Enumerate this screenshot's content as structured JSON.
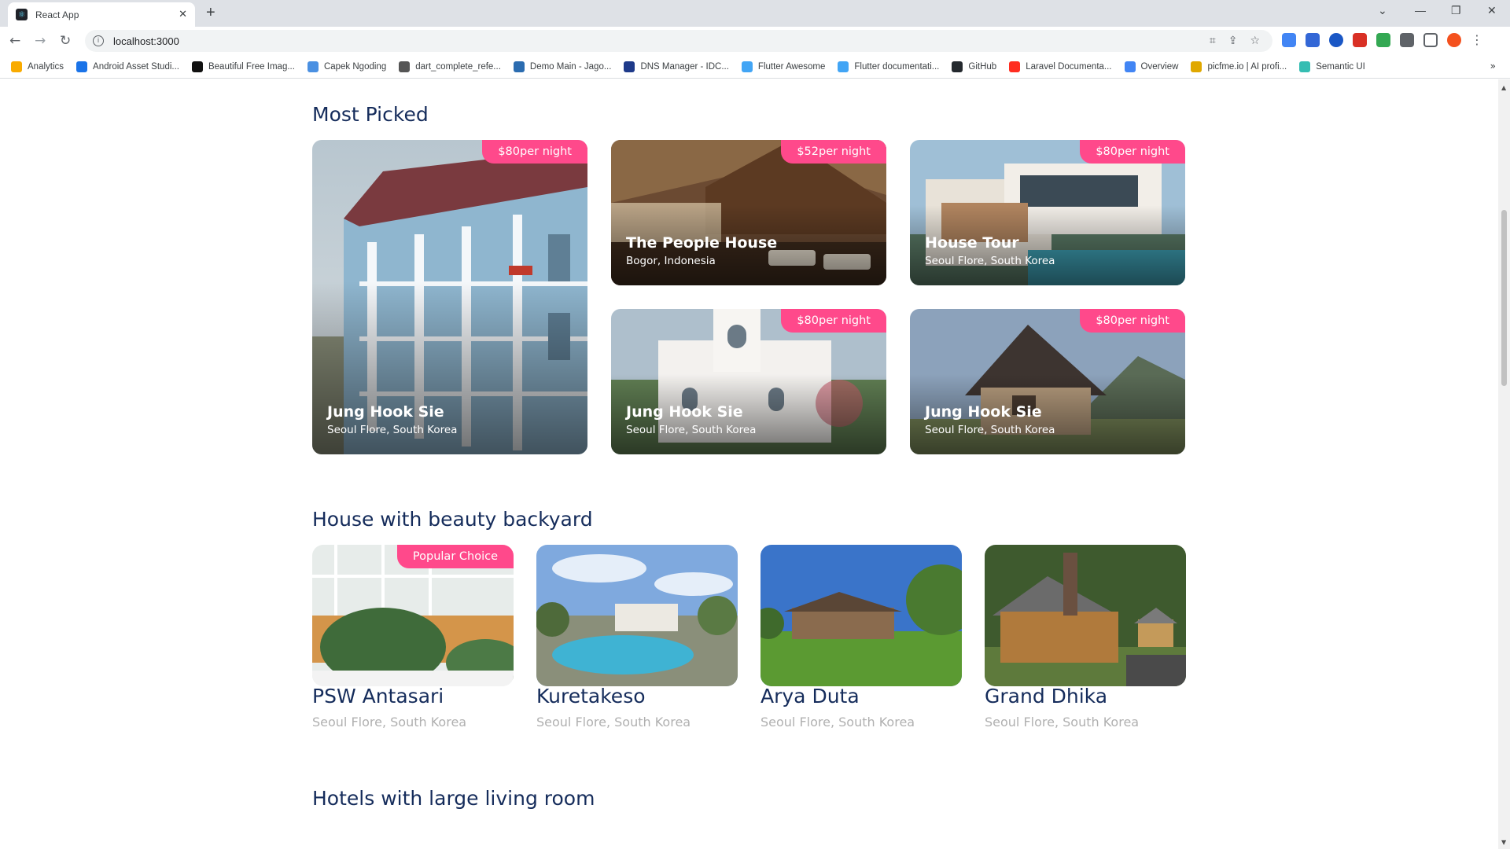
{
  "browser": {
    "tab_title": "React App",
    "url": "localhost:3000",
    "bookmarks": [
      {
        "label": "Analytics",
        "icon": "analytics-icon",
        "color": "#f9ab00"
      },
      {
        "label": "Android Asset Studi...",
        "icon": "android-asset-studio-icon",
        "color": "#1a73e8"
      },
      {
        "label": "Beautiful Free Imag...",
        "icon": "unsplash-icon",
        "color": "#111111"
      },
      {
        "label": "Capek Ngoding",
        "icon": "capek-ngoding-icon",
        "color": "#4a90e2"
      },
      {
        "label": "dart_complete_refe...",
        "icon": "github-gray-icon",
        "color": "#555555"
      },
      {
        "label": "Demo Main - Jago...",
        "icon": "jago-icon",
        "color": "#2b6cb0"
      },
      {
        "label": "DNS Manager - IDC...",
        "icon": "idcloudhost-icon",
        "color": "#1e3a8a"
      },
      {
        "label": "Flutter Awesome",
        "icon": "flutter-icon",
        "color": "#42a5f5"
      },
      {
        "label": "Flutter documentati...",
        "icon": "flutter-icon",
        "color": "#42a5f5"
      },
      {
        "label": "GitHub",
        "icon": "github-icon",
        "color": "#24292e"
      },
      {
        "label": "Laravel Documenta...",
        "icon": "laravel-icon",
        "color": "#ff2d20"
      },
      {
        "label": "Overview",
        "icon": "overview-icon",
        "color": "#4285f4"
      },
      {
        "label": "picfme.io | AI profi...",
        "icon": "picfme-icon",
        "color": "#e0a800"
      },
      {
        "label": "Semantic UI",
        "icon": "semantic-ui-icon",
        "color": "#35bdb2"
      }
    ]
  },
  "most_picked": {
    "title": "Most Picked",
    "cards": [
      {
        "price": "$80",
        "unit": "per night",
        "name": "Jung Hook Sie",
        "location": "Seoul Flore, South Korea"
      },
      {
        "price": "$52",
        "unit": "per night",
        "name": "The People House",
        "location": "Bogor, Indonesia"
      },
      {
        "price": "$80",
        "unit": "per night",
        "name": "House Tour",
        "location": "Seoul Flore, South Korea"
      },
      {
        "price": "$80",
        "unit": "per night",
        "name": "Jung Hook Sie",
        "location": "Seoul Flore, South Korea"
      },
      {
        "price": "$80",
        "unit": "per night",
        "name": "Jung Hook Sie",
        "location": "Seoul Flore, South Korea"
      }
    ]
  },
  "backyard": {
    "title": "House with beauty backyard",
    "badge": "Popular Choice",
    "items": [
      {
        "name": "PSW Antasari",
        "location": "Seoul Flore, South Korea"
      },
      {
        "name": "Kuretakeso",
        "location": "Seoul Flore, South Korea"
      },
      {
        "name": "Arya Duta",
        "location": "Seoul Flore, South Korea"
      },
      {
        "name": "Grand Dhika",
        "location": "Seoul Flore, South Korea"
      }
    ]
  },
  "living_room": {
    "title": "Hotels with large living room"
  },
  "colors": {
    "accent": "#ff498b",
    "heading": "#152c5b",
    "muted": "#b0b0b0"
  }
}
